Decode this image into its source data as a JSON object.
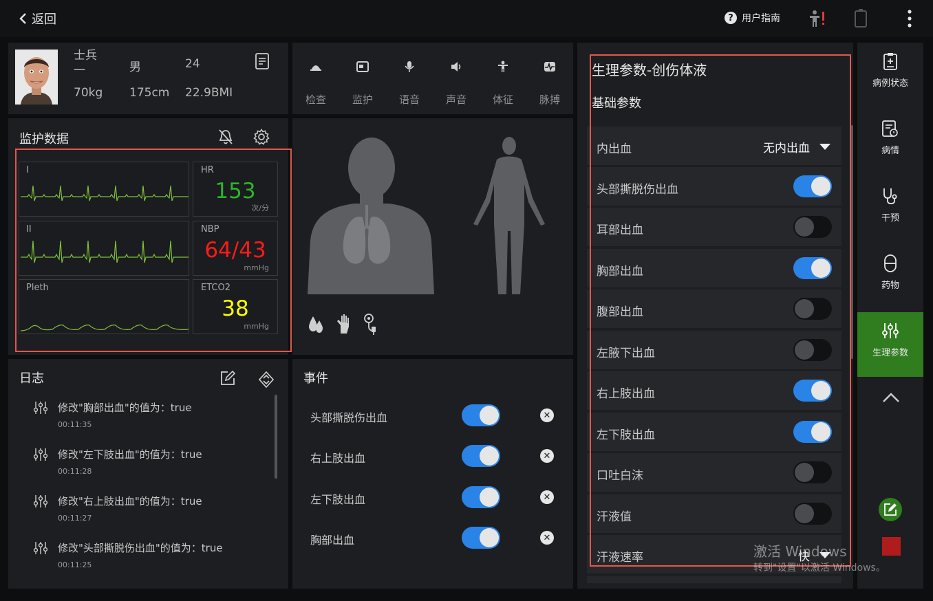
{
  "topbar": {
    "back_label": "返回",
    "guide_label": "用户指南"
  },
  "patient": {
    "name_line1": "士兵",
    "name_line2": "一",
    "gender": "男",
    "age": "24",
    "weight": "70kg",
    "height": "175cm",
    "bmi": "22.9BMI"
  },
  "toolbar": {
    "items": [
      {
        "label": "检查",
        "icon": "ultrasound-icon"
      },
      {
        "label": "监护",
        "icon": "monitor-icon"
      },
      {
        "label": "语音",
        "icon": "microphone-icon"
      },
      {
        "label": "声音",
        "icon": "speaker-icon"
      },
      {
        "label": "体征",
        "icon": "body-sign-icon"
      },
      {
        "label": "脉搏",
        "icon": "pulse-icon"
      }
    ]
  },
  "monitor": {
    "title": "监护数据",
    "waves": [
      {
        "label": "I"
      },
      {
        "label": "II"
      },
      {
        "label": "Pleth"
      }
    ],
    "vitals": [
      {
        "label": "HR",
        "value": "153",
        "unit": "次/分",
        "color": "#2bb52b"
      },
      {
        "label": "NBP",
        "value": "64/43",
        "unit": "mmHg",
        "color": "#ff1a1a"
      },
      {
        "label": "ETCO2",
        "value": "38",
        "unit": "mmHg",
        "color": "#ffff00"
      }
    ],
    "wave_color": "#7ec13a"
  },
  "log": {
    "title": "日志",
    "entries": [
      {
        "text": "修改\"胸部出血\"的值为：true",
        "time": "00:11:35"
      },
      {
        "text": "修改\"左下肢出血\"的值为：true",
        "time": "00:11:28"
      },
      {
        "text": "修改\"右上肢出血\"的值为：true",
        "time": "00:11:27"
      },
      {
        "text": "修改\"头部撕脱伤出血\"的值为：true",
        "time": "00:11:25"
      }
    ]
  },
  "events": {
    "title": "事件",
    "items": [
      {
        "label": "头部撕脱伤出血",
        "on": true
      },
      {
        "label": "右上肢出血",
        "on": true
      },
      {
        "label": "左下肢出血",
        "on": true
      },
      {
        "label": "胸部出血",
        "on": true
      }
    ]
  },
  "params": {
    "title": "生理参数-创伤体液",
    "section": "基础参数",
    "rows": [
      {
        "label": "内出血",
        "type": "select",
        "value": "无内出血"
      },
      {
        "label": "头部撕脱伤出血",
        "type": "toggle",
        "on": true
      },
      {
        "label": "耳部出血",
        "type": "toggle",
        "on": false
      },
      {
        "label": "胸部出血",
        "type": "toggle",
        "on": true
      },
      {
        "label": "腹部出血",
        "type": "toggle",
        "on": false
      },
      {
        "label": "左腋下出血",
        "type": "toggle",
        "on": false
      },
      {
        "label": "右上肢出血",
        "type": "toggle",
        "on": true
      },
      {
        "label": "左下肢出血",
        "type": "toggle",
        "on": true
      },
      {
        "label": "口吐白沫",
        "type": "toggle",
        "on": false
      },
      {
        "label": "汗液值",
        "type": "toggle",
        "on": false
      },
      {
        "label": "汗液速率",
        "type": "select",
        "value": "快"
      }
    ]
  },
  "rightnav": {
    "items": [
      {
        "label": "病例状态",
        "icon": "clipboard-icon"
      },
      {
        "label": "病情",
        "icon": "condition-icon"
      },
      {
        "label": "干预",
        "icon": "stethoscope-icon"
      },
      {
        "label": "药物",
        "icon": "pill-icon"
      },
      {
        "label": "生理参数",
        "icon": "sliders-icon",
        "active": true
      }
    ],
    "active_color": "#2f7d1f"
  },
  "watermark": {
    "line1": "激活 Windows",
    "line2": "转到\"设置\"以激活 Windows。"
  }
}
